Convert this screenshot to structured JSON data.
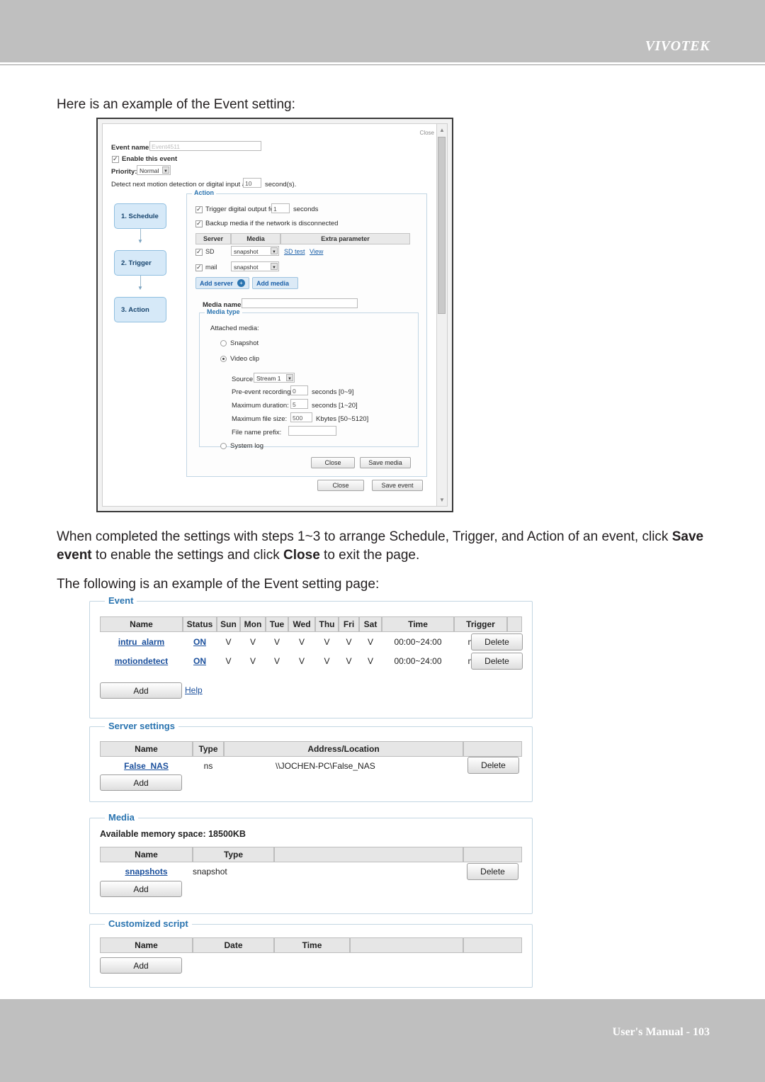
{
  "page": {
    "brand": "VIVOTEK",
    "footer": "User's Manual - 103"
  },
  "text": {
    "intro": "Here is an example of the Event setting:",
    "para2_a": "When completed the settings with steps 1~3 to arrange Schedule, Trigger, and Action of an event, click ",
    "para2_b": "Save event",
    "para2_c": " to enable the settings and click ",
    "para2_d": "Close",
    "para2_e": " to exit the page.",
    "para3": "The following is an example of the Event setting page:"
  },
  "dialog": {
    "close_top": "Close",
    "event_name_label": "Event name:",
    "event_name_value": "Event4511",
    "enable_event": "Enable this event",
    "priority_label": "Priority:",
    "priority_value": "Normal",
    "detect_label": "Detect next motion detection or digital input after",
    "detect_value": "10",
    "detect_suffix": "second(s).",
    "steps": [
      {
        "label": "1. Schedule"
      },
      {
        "label": "2. Trigger"
      },
      {
        "label": "3. Action"
      }
    ],
    "action_legend": "Action",
    "trigger_do_label": "Trigger digital output for",
    "trigger_do_value": "1",
    "trigger_do_suffix": "seconds",
    "backup_label": "Backup media if the network is disconnected",
    "server_table": {
      "headers": [
        "Server",
        "Media",
        "Extra parameter"
      ],
      "rows": [
        {
          "name": "SD",
          "media": "snapshot",
          "extra1": "SD test",
          "extra2": "View"
        },
        {
          "name": "mail",
          "media": "snapshot",
          "extra1": "",
          "extra2": ""
        }
      ]
    },
    "add_server": "Add server",
    "add_media": "Add media",
    "media_name_label": "Media name:",
    "media_name_value": "",
    "media_type_legend": "Media type",
    "attached_media_label": "Attached media:",
    "opt_snapshot": "Snapshot",
    "opt_videoclip": "Video clip",
    "opt_systemlog": "System log",
    "source_label": "Source:",
    "source_value": "Stream 1",
    "pre_event_label": "Pre-event recording:",
    "pre_event_value": "0",
    "pre_event_suffix": "seconds [0~9]",
    "max_duration_label": "Maximum duration:",
    "max_duration_value": "5",
    "max_duration_suffix": "seconds [1~20]",
    "max_filesize_label": "Maximum file size:",
    "max_filesize_value": "500",
    "max_filesize_suffix": "Kbytes [50~5120]",
    "file_prefix_label": "File name prefix:",
    "file_prefix_value": "",
    "btn_close_media": "Close",
    "btn_save_media": "Save media",
    "btn_close_event": "Close",
    "btn_save_event": "Save event"
  },
  "settings": {
    "event": {
      "legend": "Event",
      "headers": [
        "Name",
        "Status",
        "Sun",
        "Mon",
        "Tue",
        "Wed",
        "Thu",
        "Fri",
        "Sat",
        "Time",
        "Trigger"
      ],
      "rows": [
        {
          "name": "intru_alarm",
          "status": "ON",
          "days": [
            "V",
            "V",
            "V",
            "V",
            "V",
            "V",
            "V"
          ],
          "time": "00:00~24:00",
          "trigger": "motion",
          "delete": "Delete"
        },
        {
          "name": "motiondetect",
          "status": "ON",
          "days": [
            "V",
            "V",
            "V",
            "V",
            "V",
            "V",
            "V"
          ],
          "time": "00:00~24:00",
          "trigger": "motion",
          "delete": "Delete"
        }
      ],
      "add": "Add",
      "help": "Help"
    },
    "server": {
      "legend": "Server settings",
      "headers": [
        "Name",
        "Type",
        "Address/Location"
      ],
      "rows": [
        {
          "name": "False_NAS",
          "type": "ns",
          "address": "\\\\JOCHEN-PC\\False_NAS",
          "delete": "Delete"
        }
      ],
      "add": "Add"
    },
    "media": {
      "legend": "Media",
      "memory": "Available memory space: 18500KB",
      "headers": [
        "Name",
        "Type"
      ],
      "rows": [
        {
          "name": "snapshots",
          "type": "snapshot",
          "delete": "Delete"
        }
      ],
      "add": "Add"
    },
    "script": {
      "legend": "Customized script",
      "headers": [
        "Name",
        "Date",
        "Time"
      ],
      "rows": [],
      "add": "Add"
    }
  }
}
